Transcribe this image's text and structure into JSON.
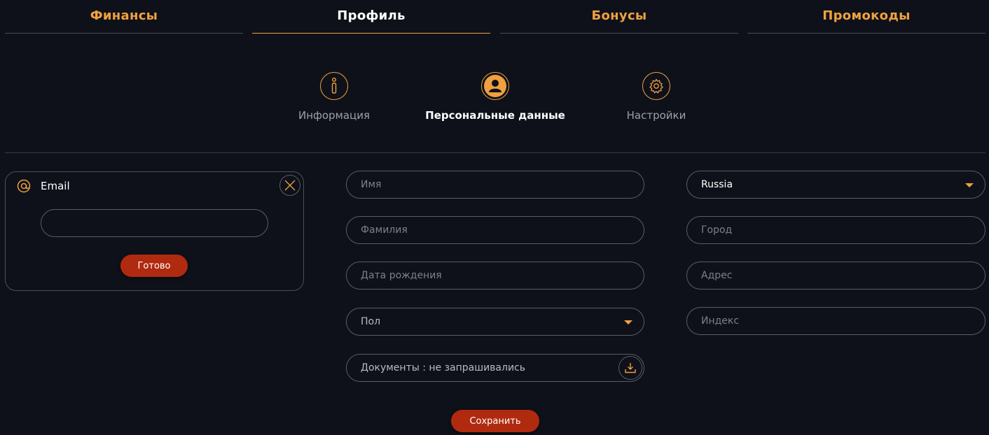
{
  "top_tabs": [
    {
      "label": "Финансы"
    },
    {
      "label": "Профиль"
    },
    {
      "label": "Бонусы"
    },
    {
      "label": "Промокоды"
    }
  ],
  "sub_tabs": [
    {
      "label": "Информация",
      "icon": "info-icon"
    },
    {
      "label": "Персональные данные",
      "icon": "user-icon"
    },
    {
      "label": "Настройки",
      "icon": "gear-icon"
    }
  ],
  "email_card": {
    "title": "Email",
    "input_value": "",
    "submit_label": "Готово"
  },
  "form": {
    "first_name_placeholder": "Имя",
    "last_name_placeholder": "Фамилия",
    "birth_date_placeholder": "Дата рождения",
    "gender_label": "Пол",
    "documents_label": "Документы : не запрашивались",
    "country_value": "Russia",
    "city_placeholder": "Город",
    "address_placeholder": "Адрес",
    "zip_placeholder": "Индекс",
    "save_label": "Сохранить"
  },
  "colors": {
    "accent": "#f0a040",
    "button_red": "#b02a10",
    "background": "#0e1119"
  }
}
